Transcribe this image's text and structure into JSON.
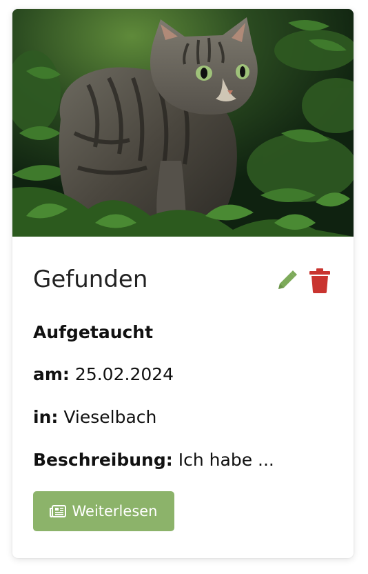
{
  "card": {
    "image_alt": "tabby cat in green foliage",
    "title": "Gefunden",
    "status_label": "Aufgetaucht",
    "date_label": "am:",
    "date_value": "25.02.2024",
    "place_label": "in:",
    "place_value": "Vieselbach",
    "description_label": "Beschreibung:",
    "description_value": "Ich habe ...",
    "read_more_label": "Weiterlesen"
  },
  "icons": {
    "edit": "pencil-icon",
    "delete": "trash-icon",
    "read_more": "newspaper-icon"
  },
  "colors": {
    "edit_icon": "#7daa5a",
    "delete_icon": "#c9342f",
    "button_bg": "#8cb36a",
    "button_text": "#ffffff"
  }
}
